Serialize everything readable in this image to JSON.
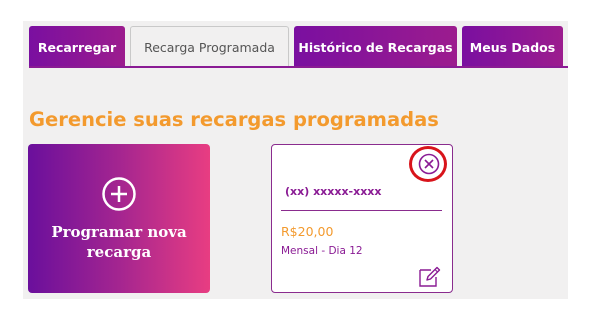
{
  "tabs": [
    {
      "label": "Recarregar",
      "active": false
    },
    {
      "label": "Recarga Programada",
      "active": true
    },
    {
      "label": "Histórico de Recargas",
      "active": false
    },
    {
      "label": "Meus Dados",
      "active": false
    }
  ],
  "page_title": "Gerencie suas recargas programadas",
  "new_card": {
    "icon": "plus-circle-icon",
    "label_line1": "Programar nova",
    "label_line2": "recarga"
  },
  "scheduled": {
    "phone": "(xx)  xxxxx-xxxx",
    "amount": "R$20,00",
    "frequency": "Mensal - Dia 12",
    "close_icon": "close-circle-icon",
    "edit_icon": "edit-icon"
  },
  "colors": {
    "brand_purple": "#8a1b94",
    "accent_orange": "#f39a2e",
    "highlight_red": "#d8141b"
  }
}
